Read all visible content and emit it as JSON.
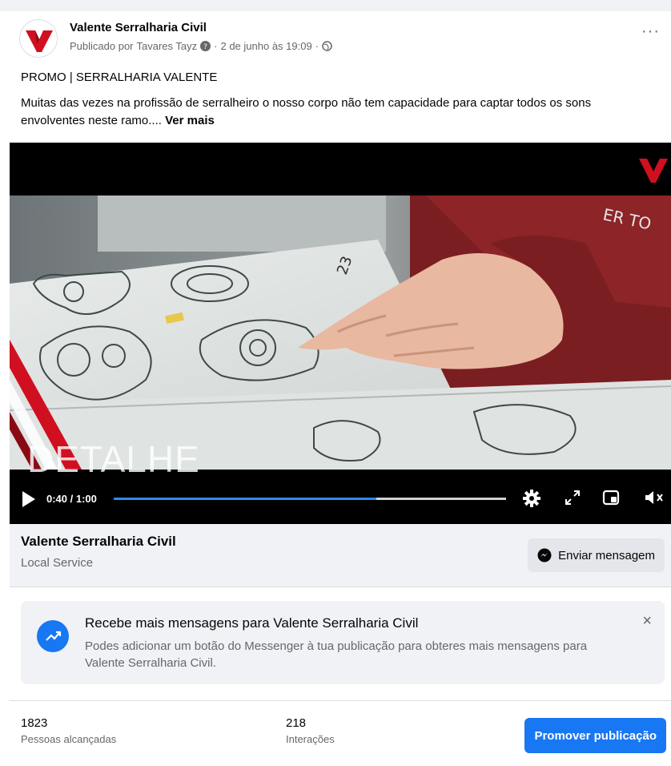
{
  "post": {
    "page_name": "Valente Serralharia Civil",
    "meta_prefix": "Publicado por",
    "author": "Tavares Tayz",
    "date": "2 de junho às 19:09",
    "separator": "·",
    "more_glyph": "···",
    "promo_title": "PROMO | SERRALHARIA VALENTE",
    "text": "Muitas das vezes na profissão de serralheiro o nosso corpo não tem capacidade para captar todos os sons envolventes neste ramo....",
    "see_more": "Ver mais"
  },
  "video": {
    "overlay_title": "DETALHE",
    "time": "0:40 / 1:00",
    "progress": 0.67,
    "icons": [
      "play-icon",
      "gear-icon",
      "expand-icon",
      "miniplayer-icon",
      "volume-muted-icon"
    ]
  },
  "page_info": {
    "name": "Valente Serralharia Civil",
    "category": "Local Service",
    "send_button": "Enviar mensagem"
  },
  "tip": {
    "title": "Recebe mais mensagens para Valente Serralharia Civil",
    "body": "Podes adicionar um botão do Messenger à tua publicação para obteres mais mensagens para Valente Serralharia Civil.",
    "close_glyph": "×"
  },
  "stats": {
    "reach_value": "1823",
    "reach_label": "Pessoas alcançadas",
    "interactions_value": "218",
    "interactions_label": "Interações",
    "promote_button": "Promover publicação"
  },
  "colors": {
    "accent": "#1877f2",
    "progress": "#2d88ff",
    "brand_red": "#d01020",
    "muted_text": "#65676b",
    "panel_bg": "#f0f2f5"
  }
}
